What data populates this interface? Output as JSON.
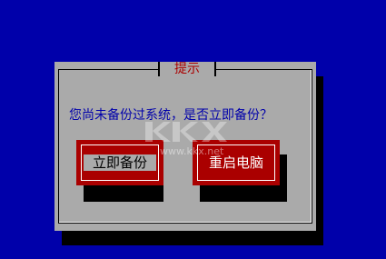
{
  "dialog": {
    "title": "提示",
    "message": "您尚未备份过系统，是否立即备份？",
    "buttons": {
      "backup_label": "立即备份",
      "reboot_label": "重启电脑"
    }
  },
  "watermark": {
    "text": "www.kkx.net"
  },
  "colors": {
    "background": "#0000aa",
    "dialog": "#aaaaaa",
    "title_text": "#aa0000",
    "message_text": "#0000aa",
    "button": "#aa0000"
  }
}
